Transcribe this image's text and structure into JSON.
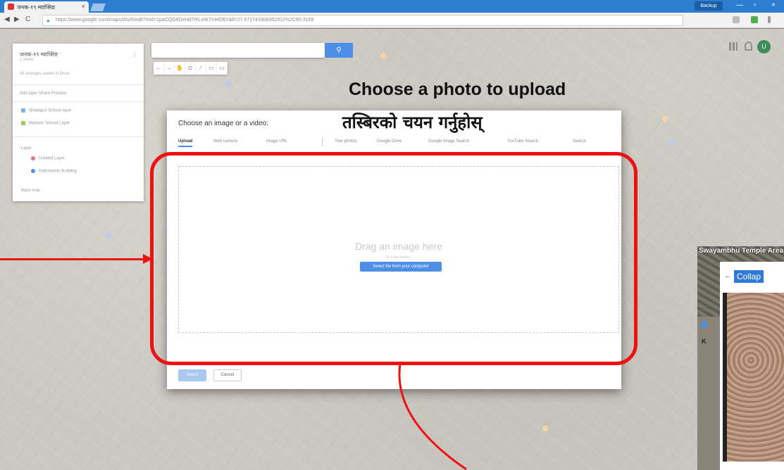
{
  "browser": {
    "tab_title": "जनक-१९ म्याप्सिङ",
    "tab_close": "×",
    "profile_label": "Backup",
    "minimize": "—",
    "maximize": "▫",
    "close": "×",
    "back": "◀",
    "forward": "▶",
    "reload": "C",
    "url": "https://www.google.com/maps/d/u/0/edit?mid=1paCQG8DxHd7rKLmK7mHDE=&ll=27.671743306962912%2C85.3169"
  },
  "left_panel": {
    "title": "जनक-१९ म्याप्सिङ",
    "subtitle": "1 views",
    "description": "All changes saved in Drive",
    "actions": "Add layer  Share  Preview",
    "layers": [
      {
        "label": "Shantipur School layer",
        "color": "#7fb3e8"
      },
      {
        "label": "Mahavir School Layer",
        "color": "#9ccc65"
      }
    ],
    "section_label": "Layer",
    "items": [
      {
        "label": "Untitled Layer",
        "color": "#e57373"
      },
      {
        "label": "Kathmandu Building",
        "color": "#4d8fe6"
      }
    ],
    "base_map": "Base map",
    "menu_icon": "⋮"
  },
  "map": {
    "search_button_icon": "search-icon",
    "search_glyph": "⚲",
    "tools": [
      "←",
      "→",
      "✋",
      "⊙",
      "⁄",
      "▭",
      "▭"
    ],
    "avatar_initial": "U"
  },
  "dialog": {
    "title": "Choose an image or a video:",
    "tabs": [
      "Upload",
      "Web camera",
      "Image URL",
      "Your photos",
      "Google Drive",
      "Google Image Search",
      "YouTube Search",
      "Search"
    ],
    "drop_text": "Drag an image here",
    "drop_or": "Or, if you prefer...",
    "select_button": "Select file from your computer",
    "select_action": "Select",
    "cancel_action": "Cancel"
  },
  "annotations": {
    "english": "Choose a photo to upload",
    "nepali": "तस्बिरको चयन गर्नुहोस्"
  },
  "inset": {
    "map_label": "Swayambhu Temple Area",
    "collapse_label": "Collap",
    "back": "←",
    "k_label": "K"
  },
  "colors": {
    "accent_blue": "#4d8fe6",
    "annotation_red": "#ee1111",
    "chrome_blue": "#2c7cd0"
  }
}
